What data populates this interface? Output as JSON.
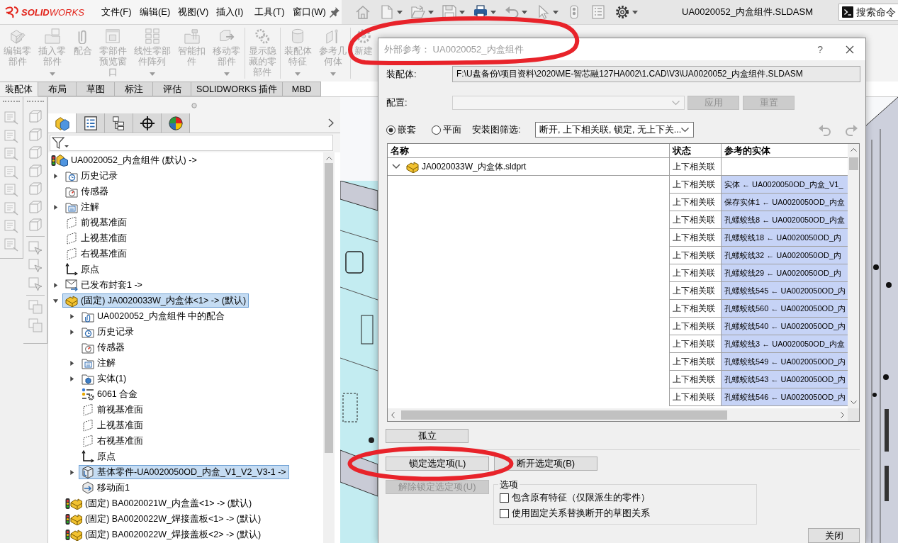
{
  "app": {
    "logo": "**SOLID**WORKS",
    "menu": [
      "文件(F)",
      "编辑(E)",
      "视图(V)",
      "插入(I)",
      "工具(T)",
      "窗口(W)"
    ],
    "document_title": "UA0020052_内盒组件.SLDASM",
    "search": {
      "placeholder": "搜索命令"
    }
  },
  "quick_access": [
    {
      "kind": "home",
      "disabled": true,
      "dropdown": false
    },
    {
      "kind": "new",
      "disabled": true,
      "dropdown": true
    },
    {
      "kind": "open",
      "disabled": true,
      "dropdown": true
    },
    {
      "kind": "save",
      "disabled": true,
      "dropdown": true
    },
    {
      "kind": "print",
      "disabled": false,
      "dropdown": true
    },
    {
      "kind": "undo",
      "disabled": true,
      "dropdown": true
    },
    {
      "kind": "select",
      "disabled": true,
      "dropdown": true
    },
    {
      "kind": "rebuild",
      "disabled": true,
      "dropdown": false
    },
    {
      "kind": "properties",
      "disabled": true,
      "dropdown": false
    },
    {
      "kind": "options",
      "disabled": false,
      "dropdown": true
    }
  ],
  "command_groups": [
    [
      {
        "kind": "edit",
        "label": "编辑零部件",
        "disabled": true,
        "dropdown": false
      },
      {
        "kind": "insert",
        "label": "插入零部件",
        "disabled": true,
        "dropdown": true
      },
      {
        "kind": "mate",
        "label": "配合",
        "disabled": true,
        "dropdown": false
      },
      {
        "kind": "preview",
        "label": "零部件预览窗口",
        "disabled": true,
        "dropdown": false
      },
      {
        "kind": "pattern",
        "label": "线性零部件阵列",
        "disabled": true,
        "dropdown": true
      },
      {
        "kind": "fastener",
        "label": "智能扣件",
        "disabled": true,
        "dropdown": false
      },
      {
        "kind": "move",
        "label": "移动零部件",
        "disabled": true,
        "dropdown": true
      }
    ],
    [
      {
        "kind": "showhidden",
        "label": "显示隐藏的零部件",
        "disabled": true,
        "dropdown": false
      }
    ],
    [
      {
        "kind": "feature",
        "label": "装配体特征",
        "disabled": true,
        "dropdown": true
      },
      {
        "kind": "refgeom",
        "label": "参考几何体",
        "disabled": true,
        "dropdown": true
      }
    ],
    [
      {
        "kind": "motion",
        "label": "新建",
        "disabled": true,
        "dropdown": false
      }
    ]
  ],
  "tabs": [
    {
      "label": "装配体",
      "selected": true
    },
    {
      "label": "布局",
      "selected": false
    },
    {
      "label": "草图",
      "selected": false
    },
    {
      "label": "标注",
      "selected": false
    },
    {
      "label": "评估",
      "selected": false
    },
    {
      "label": "SOLIDWORKS 插件",
      "selected": false
    },
    {
      "label": "MBD",
      "selected": false
    }
  ],
  "feature_panel": {
    "tabs": [
      {
        "kind": "features",
        "selected": true
      },
      {
        "kind": "properties",
        "selected": false
      },
      {
        "kind": "configurations",
        "selected": false
      },
      {
        "kind": "dimxpert",
        "selected": false
      },
      {
        "kind": "display",
        "selected": false
      }
    ],
    "tree": [
      {
        "label": "UA0020052_内盒组件 (默认) ->",
        "kind": "assembly",
        "selected": false,
        "children": [
          {
            "label": "历史记录",
            "kind": "history",
            "expanded": false,
            "selected": false
          },
          {
            "label": "传感器",
            "kind": "sensors",
            "selected": false
          },
          {
            "label": "注解",
            "kind": "annotations",
            "expanded": false,
            "selected": false
          },
          {
            "label": "前视基准面",
            "kind": "plane",
            "selected": false
          },
          {
            "label": "上视基准面",
            "kind": "plane",
            "selected": false
          },
          {
            "label": "右视基准面",
            "kind": "plane",
            "selected": false
          },
          {
            "label": "原点",
            "kind": "origin",
            "selected": false
          },
          {
            "label": "已发布封套1 ->",
            "kind": "envelope",
            "expanded": false,
            "selected": false
          },
          {
            "label": "(固定) JA0020033W_内盒体<1> -> (默认)",
            "kind": "part",
            "expanded": true,
            "selected": true,
            "children": [
              {
                "label": "UA0020052_内盒组件 中的配合",
                "kind": "mates",
                "expanded": false,
                "selected": false
              },
              {
                "label": "历史记录",
                "kind": "history",
                "expanded": false,
                "selected": false
              },
              {
                "label": "传感器",
                "kind": "sensors",
                "selected": false
              },
              {
                "label": "注解",
                "kind": "annotations",
                "expanded": false,
                "selected": false
              },
              {
                "label": "实体(1)",
                "kind": "bodies",
                "expanded": false,
                "selected": false
              },
              {
                "label": "6061 合金",
                "kind": "material",
                "selected": false
              },
              {
                "label": "前视基准面",
                "kind": "plane",
                "selected": false
              },
              {
                "label": "上视基准面",
                "kind": "plane",
                "selected": false
              },
              {
                "label": "右视基准面",
                "kind": "plane",
                "selected": false
              },
              {
                "label": "原点",
                "kind": "origin",
                "selected": false
              },
              {
                "label": "基体零件-UA0020050OD_内盒_V1_V2_V3-1 ->",
                "kind": "basepart",
                "expanded": false,
                "selected": true
              },
              {
                "label": "移动面1",
                "kind": "moveface",
                "selected": false
              }
            ]
          },
          {
            "label": "(固定) BA0020021W_内盒盖<1> -> (默认)",
            "kind": "flaggedpart",
            "selected": false
          },
          {
            "label": "(固定) BA0020022W_焊接盖板<1> -> (默认)",
            "kind": "flaggedpart",
            "selected": false
          },
          {
            "label": "(固定) BA0020022W_焊接盖板<2> -> (默认)",
            "kind": "flaggedpart",
            "selected": false
          }
        ]
      }
    ]
  },
  "dialog": {
    "title": "外部参考： UA0020052_内盒组件",
    "circled": true,
    "help": "?",
    "assembly": {
      "label": "装配体:",
      "path": "F:\\U盘备份\\项目资料\\2020\\ME-智芯融127HA002\\1.CAD\\V3\\UA0020052_内盒组件.SLDASM"
    },
    "configuration": {
      "label": "配置:",
      "disabled": true
    },
    "config_buttons": [
      {
        "label": "应用",
        "disabled": true
      },
      {
        "label": "重置",
        "disabled": true
      }
    ],
    "view_modes": [
      {
        "label": "嵌套",
        "selected": true
      },
      {
        "label": "平面",
        "selected": false
      }
    ],
    "filter": {
      "label": "安装图筛选:",
      "value": "断开, 上下相关联, 锁定, 无上下关..."
    },
    "history_buttons": [
      {
        "kind": "undo",
        "disabled": true
      },
      {
        "kind": "redo",
        "disabled": true
      }
    ],
    "table": {
      "columns": [
        "名称",
        "状态",
        "参考的实体"
      ],
      "rows": [
        {
          "name": "JA0020033W_内盒体.sldprt",
          "status": "上下相关联",
          "expanded": true,
          "children": [
            {
              "status": "上下相关联",
              "entity": "实体 ← UA0020050OD_内盒_V1_"
            },
            {
              "status": "上下相关联",
              "entity": "保存实体1 ← UA0020050OD_内盒"
            },
            {
              "status": "上下相关联",
              "entity": "孔螺蛟线8 ← UA0020050OD_内盒"
            },
            {
              "status": "上下相关联",
              "entity": "孔螺蛟线18 ← UA0020050OD_内"
            },
            {
              "status": "上下相关联",
              "entity": "孔螺蛟线32 ← UA0020050OD_内"
            },
            {
              "status": "上下相关联",
              "entity": "孔螺蛟线29 ← UA0020050OD_内"
            },
            {
              "status": "上下相关联",
              "entity": "孔螺蛟线545 ← UA0020050OD_内"
            },
            {
              "status": "上下相关联",
              "entity": "孔螺蛟线560 ← UA0020050OD_内"
            },
            {
              "status": "上下相关联",
              "entity": "孔螺蛟线540 ← UA0020050OD_内"
            },
            {
              "status": "上下相关联",
              "entity": "孔螺蛟线3 ← UA0020050OD_内盒"
            },
            {
              "status": "上下相关联",
              "entity": "孔螺蛟线549 ← UA0020050OD_内"
            },
            {
              "status": "上下相关联",
              "entity": "孔螺蛟线543 ← UA0020050OD_内"
            },
            {
              "status": "上下相关联",
              "entity": "孔螺蛟线546 ← UA0020050OD_内"
            }
          ]
        }
      ]
    },
    "isolate_button": "孤立",
    "action_buttons": [
      {
        "label": "锁定选定项(L)",
        "disabled": false,
        "circled": true
      },
      {
        "label": "断开选定项(B)",
        "disabled": false,
        "circled": false
      },
      {
        "label": "解除锁定选定项(U)",
        "disabled": true,
        "circled": false
      }
    ],
    "options": {
      "title": "选项",
      "items": [
        {
          "label": "包含原有特征（仅限派生的零件）",
          "checked": false
        },
        {
          "label": "使用固定关系替换断开的草图关系",
          "checked": false
        }
      ]
    },
    "close_button": "关闭"
  }
}
